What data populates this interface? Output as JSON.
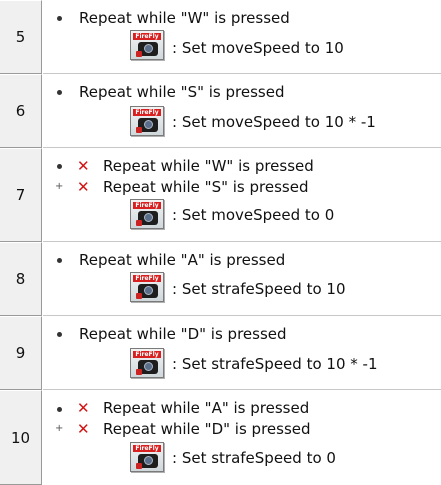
{
  "rows": [
    {
      "number": "5",
      "conditions": [
        {
          "marker": "bullet",
          "negated": false,
          "text": "Repeat while \"W\" is pressed"
        }
      ],
      "action": {
        "icon": "firefly-camera-icon",
        "icon_text": "FireFly",
        "text": ": Set moveSpeed to 10"
      }
    },
    {
      "number": "6",
      "conditions": [
        {
          "marker": "bullet",
          "negated": false,
          "text": "Repeat while \"S\" is pressed"
        }
      ],
      "action": {
        "icon": "firefly-camera-icon",
        "icon_text": "FireFly",
        "text": ": Set moveSpeed to 10 * -1"
      }
    },
    {
      "number": "7",
      "conditions": [
        {
          "marker": "bullet",
          "negated": true,
          "text": "Repeat while \"W\" is pressed"
        },
        {
          "marker": "plus",
          "negated": true,
          "text": "Repeat while \"S\" is pressed"
        }
      ],
      "action": {
        "icon": "firefly-camera-icon",
        "icon_text": "FireFly",
        "text": ": Set moveSpeed to 0"
      }
    },
    {
      "number": "8",
      "conditions": [
        {
          "marker": "bullet",
          "negated": false,
          "text": "Repeat while \"A\" is pressed"
        }
      ],
      "action": {
        "icon": "firefly-camera-icon",
        "icon_text": "FireFly",
        "text": ": Set strafeSpeed to 10"
      }
    },
    {
      "number": "9",
      "conditions": [
        {
          "marker": "bullet",
          "negated": false,
          "text": "Repeat while \"D\" is pressed"
        }
      ],
      "action": {
        "icon": "firefly-camera-icon",
        "icon_text": "FireFly",
        "text": ": Set strafeSpeed to 10 * -1"
      }
    },
    {
      "number": "10",
      "conditions": [
        {
          "marker": "bullet",
          "negated": true,
          "text": "Repeat while \"A\" is pressed"
        },
        {
          "marker": "plus",
          "negated": true,
          "text": "Repeat while \"D\" is pressed"
        }
      ],
      "action": {
        "icon": "firefly-camera-icon",
        "icon_text": "FireFly",
        "text": ": Set strafeSpeed to 0"
      }
    }
  ],
  "colors": {
    "negation_x": "#d21414",
    "row_number_bg": "#f0f0f0",
    "separator": "#c8c8c8"
  }
}
